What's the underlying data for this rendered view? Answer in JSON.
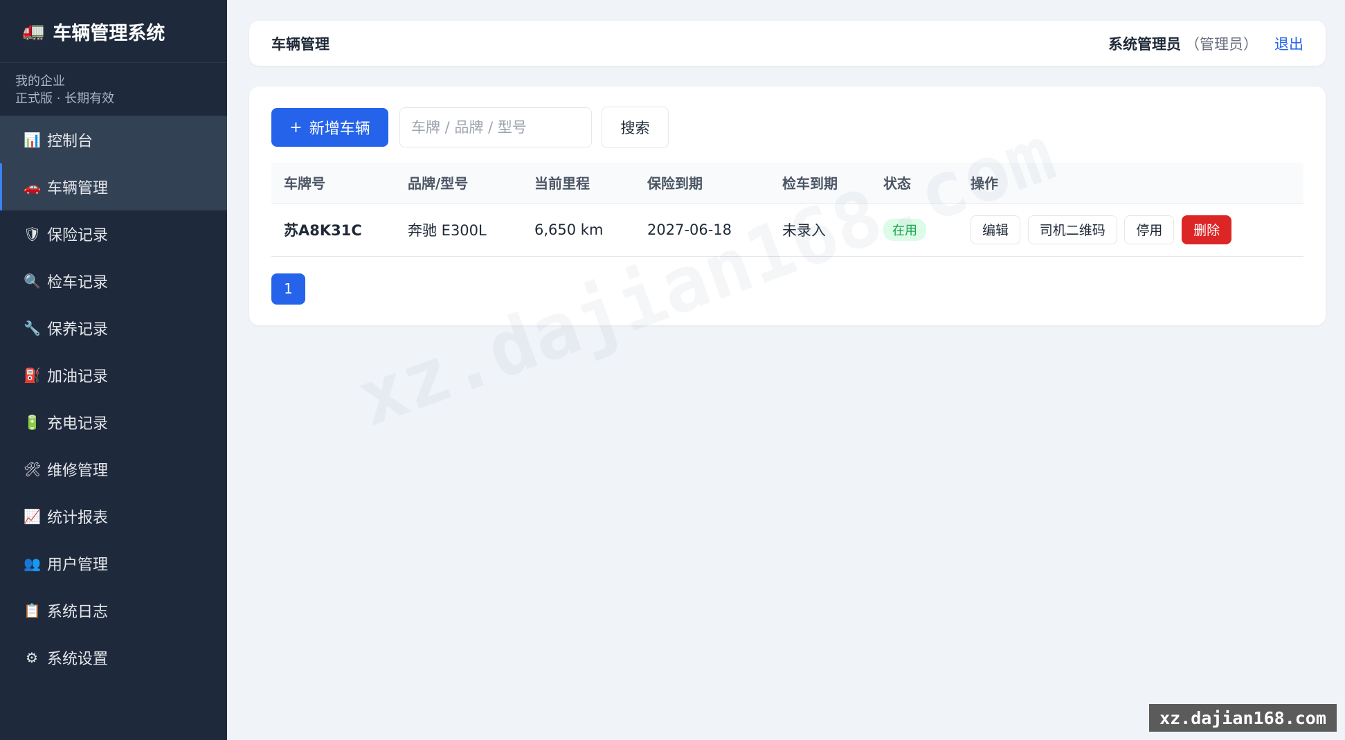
{
  "sidebar": {
    "brand": {
      "icon": "🚛",
      "title": "车辆管理系统"
    },
    "org": {
      "name": "我的企业",
      "plan": "正式版 · 长期有效"
    },
    "items": [
      {
        "icon": "📊",
        "label": "控制台"
      },
      {
        "icon": "🚗",
        "label": "车辆管理"
      },
      {
        "icon": "🛡",
        "label": "保险记录"
      },
      {
        "icon": "🔍",
        "label": "检车记录"
      },
      {
        "icon": "🔧",
        "label": "保养记录"
      },
      {
        "icon": "⛽",
        "label": "加油记录"
      },
      {
        "icon": "🔋",
        "label": "充电记录"
      },
      {
        "icon": "🛠",
        "label": "维修管理"
      },
      {
        "icon": "📈",
        "label": "统计报表"
      },
      {
        "icon": "👥",
        "label": "用户管理"
      },
      {
        "icon": "📋",
        "label": "系统日志"
      },
      {
        "icon": "⚙",
        "label": "系统设置"
      }
    ]
  },
  "header": {
    "title": "车辆管理",
    "user_name": "系统管理员",
    "user_role": "（管理员）",
    "logout_label": "退出"
  },
  "toolbar": {
    "add_icon": "+",
    "add_label": "新增车辆",
    "search_placeholder": "车牌 / 品牌 / 型号",
    "search_label": "搜索"
  },
  "table": {
    "columns": [
      "车牌号",
      "品牌/型号",
      "当前里程",
      "保险到期",
      "检车到期",
      "状态",
      "操作"
    ],
    "rows": [
      {
        "plate": "苏A8K31C",
        "model": "奔驰 E300L",
        "mileage": "6,650 km",
        "insurance_due": "2027-06-18",
        "inspection_due": "未录入",
        "status": "在用",
        "actions": [
          "编辑",
          "司机二维码",
          "停用",
          "删除"
        ]
      }
    ]
  },
  "pagination": {
    "current": "1"
  },
  "watermark": {
    "text": "xz.dajian168.com",
    "corner": "xz.dajian168.com"
  },
  "colors": {
    "primary": "#2563eb",
    "sidebar": "#1e293b",
    "danger": "#dc2626",
    "success": "#16a34a"
  }
}
